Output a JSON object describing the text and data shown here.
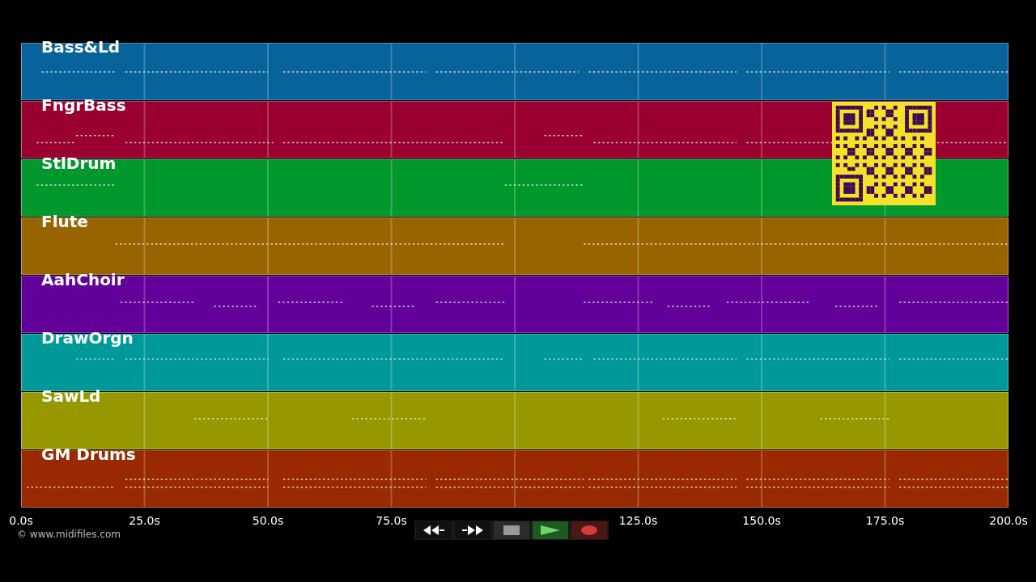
{
  "lanes": [
    {
      "name": "Bass&Ld",
      "color": "#076399"
    },
    {
      "name": "FngrBass",
      "color": "#990030"
    },
    {
      "name": "StlDrum",
      "color": "#00982c"
    },
    {
      "name": "Flute",
      "color": "#976400"
    },
    {
      "name": "AahChoir",
      "color": "#630099"
    },
    {
      "name": "DrawOrgn",
      "color": "#009999"
    },
    {
      "name": "SawLd",
      "color": "#979800"
    },
    {
      "name": "GM Drums",
      "color": "#982900"
    }
  ],
  "axis_labels": [
    "0.0s",
    "25.0s",
    "50.0s",
    "75.0s",
    "125.0s",
    "150.0s",
    "175.0s",
    "200.0s"
  ],
  "credit": "© www.midifiles.com"
}
